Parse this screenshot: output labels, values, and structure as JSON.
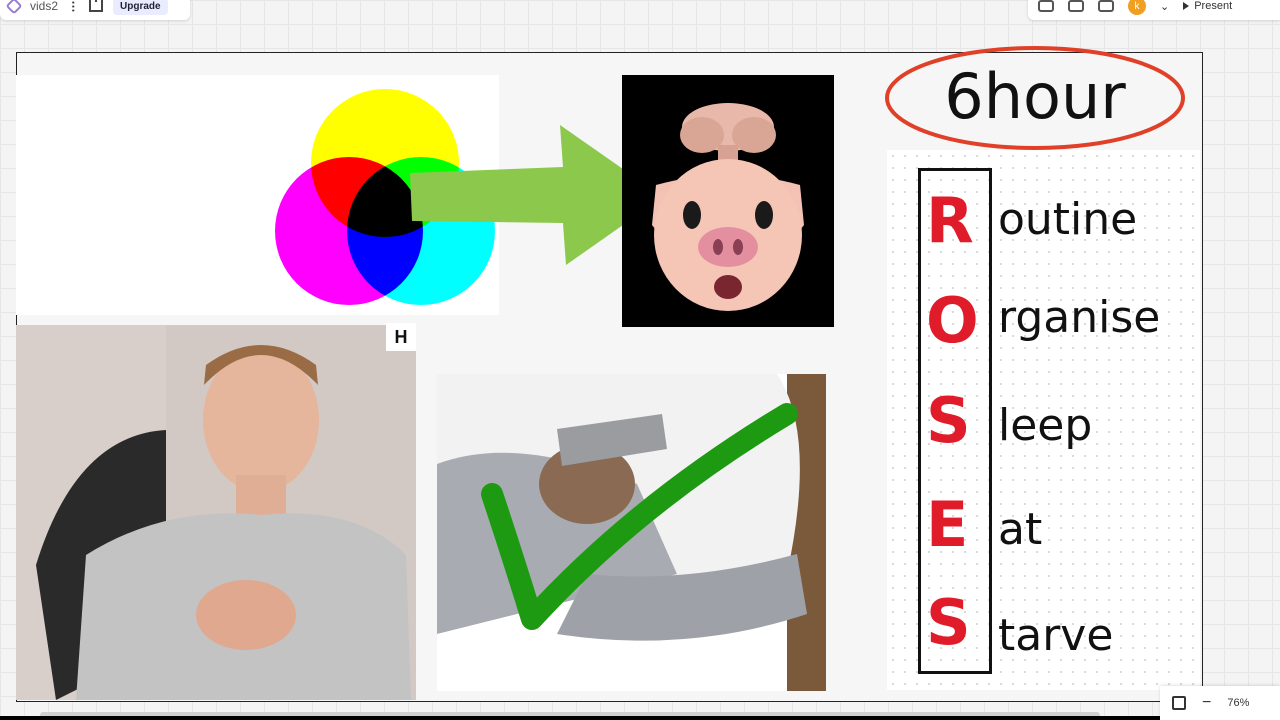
{
  "toolbar_left": {
    "board_name": "vids2",
    "upgrade_label": "Upgrade"
  },
  "toolbar_right": {
    "avatar_initial": "k",
    "present_label": "Present"
  },
  "zoom": {
    "level": "76%"
  },
  "heading": {
    "text": "6hour"
  },
  "h_tag": {
    "text": "H"
  },
  "roses": {
    "letters": [
      "R",
      "O",
      "S",
      "E",
      "S"
    ],
    "words": [
      "outine",
      "rganise",
      "leep",
      "at",
      "tarve"
    ]
  },
  "colors": {
    "red_accent": "#e01c2a",
    "arrow_green": "#8cc84b",
    "check_green": "#1e9a12"
  }
}
